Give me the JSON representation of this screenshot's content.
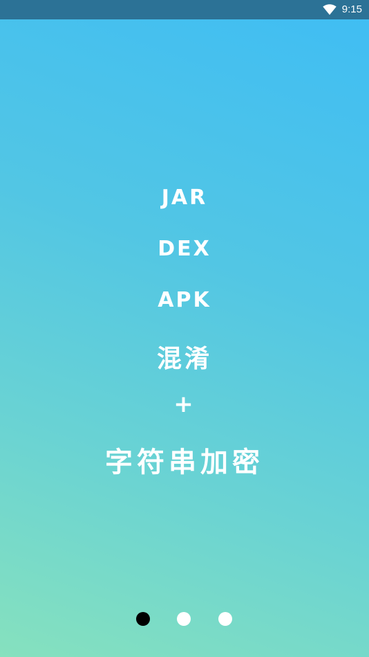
{
  "status_bar": {
    "time": "9:15",
    "wifi_icon": "wifi-icon"
  },
  "slide": {
    "lines": [
      "JAR",
      "DEX",
      "APK",
      "混淆",
      "+",
      "字符串加密"
    ]
  },
  "pager": {
    "count": 3,
    "active_index": 0
  },
  "colors": {
    "status_bar": "#2c7296",
    "gradient_top": "#3fbdf4",
    "gradient_bottom": "#86e1be",
    "text": "#ffffff",
    "dot_active": "#000000",
    "dot_inactive": "#ffffff"
  }
}
